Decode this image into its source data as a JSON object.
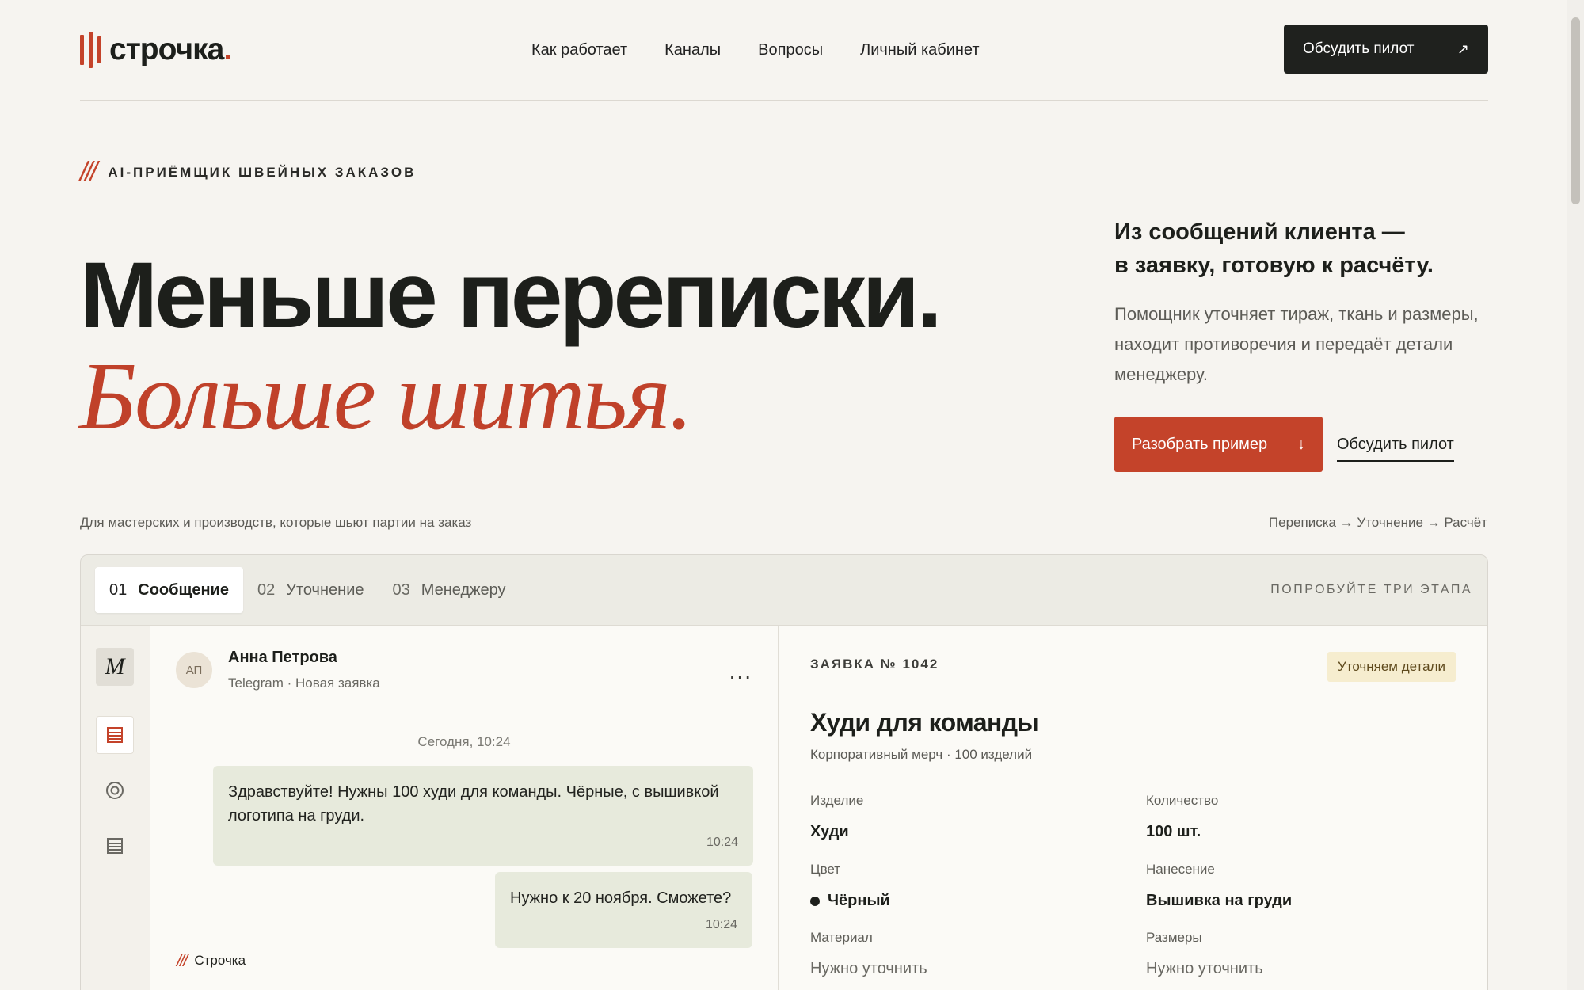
{
  "brand": {
    "name": "строчка",
    "dot": "."
  },
  "nav": [
    "Как работает",
    "Каналы",
    "Вопросы",
    "Личный кабинет"
  ],
  "header_cta": {
    "label": "Обсудить пилот",
    "icon": "arrow-up-right-icon"
  },
  "hero": {
    "eyebrow": "AI-ПРИЁМЩИК ШВЕЙНЫХ ЗАКАЗОВ",
    "eyebrow_marks": "///",
    "title": "Меньше переписки.",
    "title_accent": "Больше шитья.",
    "lead_line1": "Из сообщений клиента —",
    "lead_line2": "в заявку, готовую к расчёту.",
    "description": "Помощник уточняет тираж, ткань и размеры, находит противоречия и передаёт детали менеджеру.",
    "primary_cta": "Разобрать пример",
    "secondary_cta": "Обсудить пилот",
    "audience": "Для мастерских и производств, которые шьют партии на заказ",
    "flow": "Переписка → Уточнение → Расчёт"
  },
  "demo": {
    "tabs": [
      {
        "num": "01",
        "label": "Сообщение",
        "active": true
      },
      {
        "num": "02",
        "label": "Уточнение",
        "active": false
      },
      {
        "num": "03",
        "label": "Менеджеру",
        "active": false
      }
    ],
    "tabs_hint": "ПОПРОБУЙТЕ ТРИ ЭТАПА",
    "rail": {
      "logo_letter": "M"
    },
    "chat": {
      "avatar_initials": "АП",
      "name": "Анна Петрова",
      "meta": "Telegram · Новая заявка",
      "more": "...",
      "day": "Сегодня, 10:24",
      "messages": [
        {
          "text": "Здравствуйте! Нужны 100 худи для команды. Чёрные, с вышивкой логотипа на груди.",
          "time": "10:24"
        },
        {
          "text": "Нужно к 20 ноября. Сможете?",
          "time": "10:24"
        }
      ],
      "bot_marks": "///",
      "bot_name": "Строчка"
    },
    "order": {
      "id": "ЗАЯВКА № 1042",
      "status": "Уточняем детали",
      "title": "Худи для команды",
      "subtitle": "Корпоративный мерч · 100 изделий",
      "fields": [
        {
          "key": "Изделие",
          "value": "Худи"
        },
        {
          "key": "Количество",
          "value": "100 шт."
        },
        {
          "key": "Цвет",
          "value": "Чёрный"
        },
        {
          "key": "Нанесение",
          "value": "Вышивка на груди"
        },
        {
          "key": "Материал",
          "value": "Нужно уточнить"
        },
        {
          "key": "Размеры",
          "value": "Нужно уточнить"
        }
      ]
    }
  },
  "colors": {
    "accent": "#c4432a",
    "dark": "#1f211e",
    "background": "#f6f4f0",
    "bubble": "#e7eadc",
    "badge": "#f6edcf"
  }
}
